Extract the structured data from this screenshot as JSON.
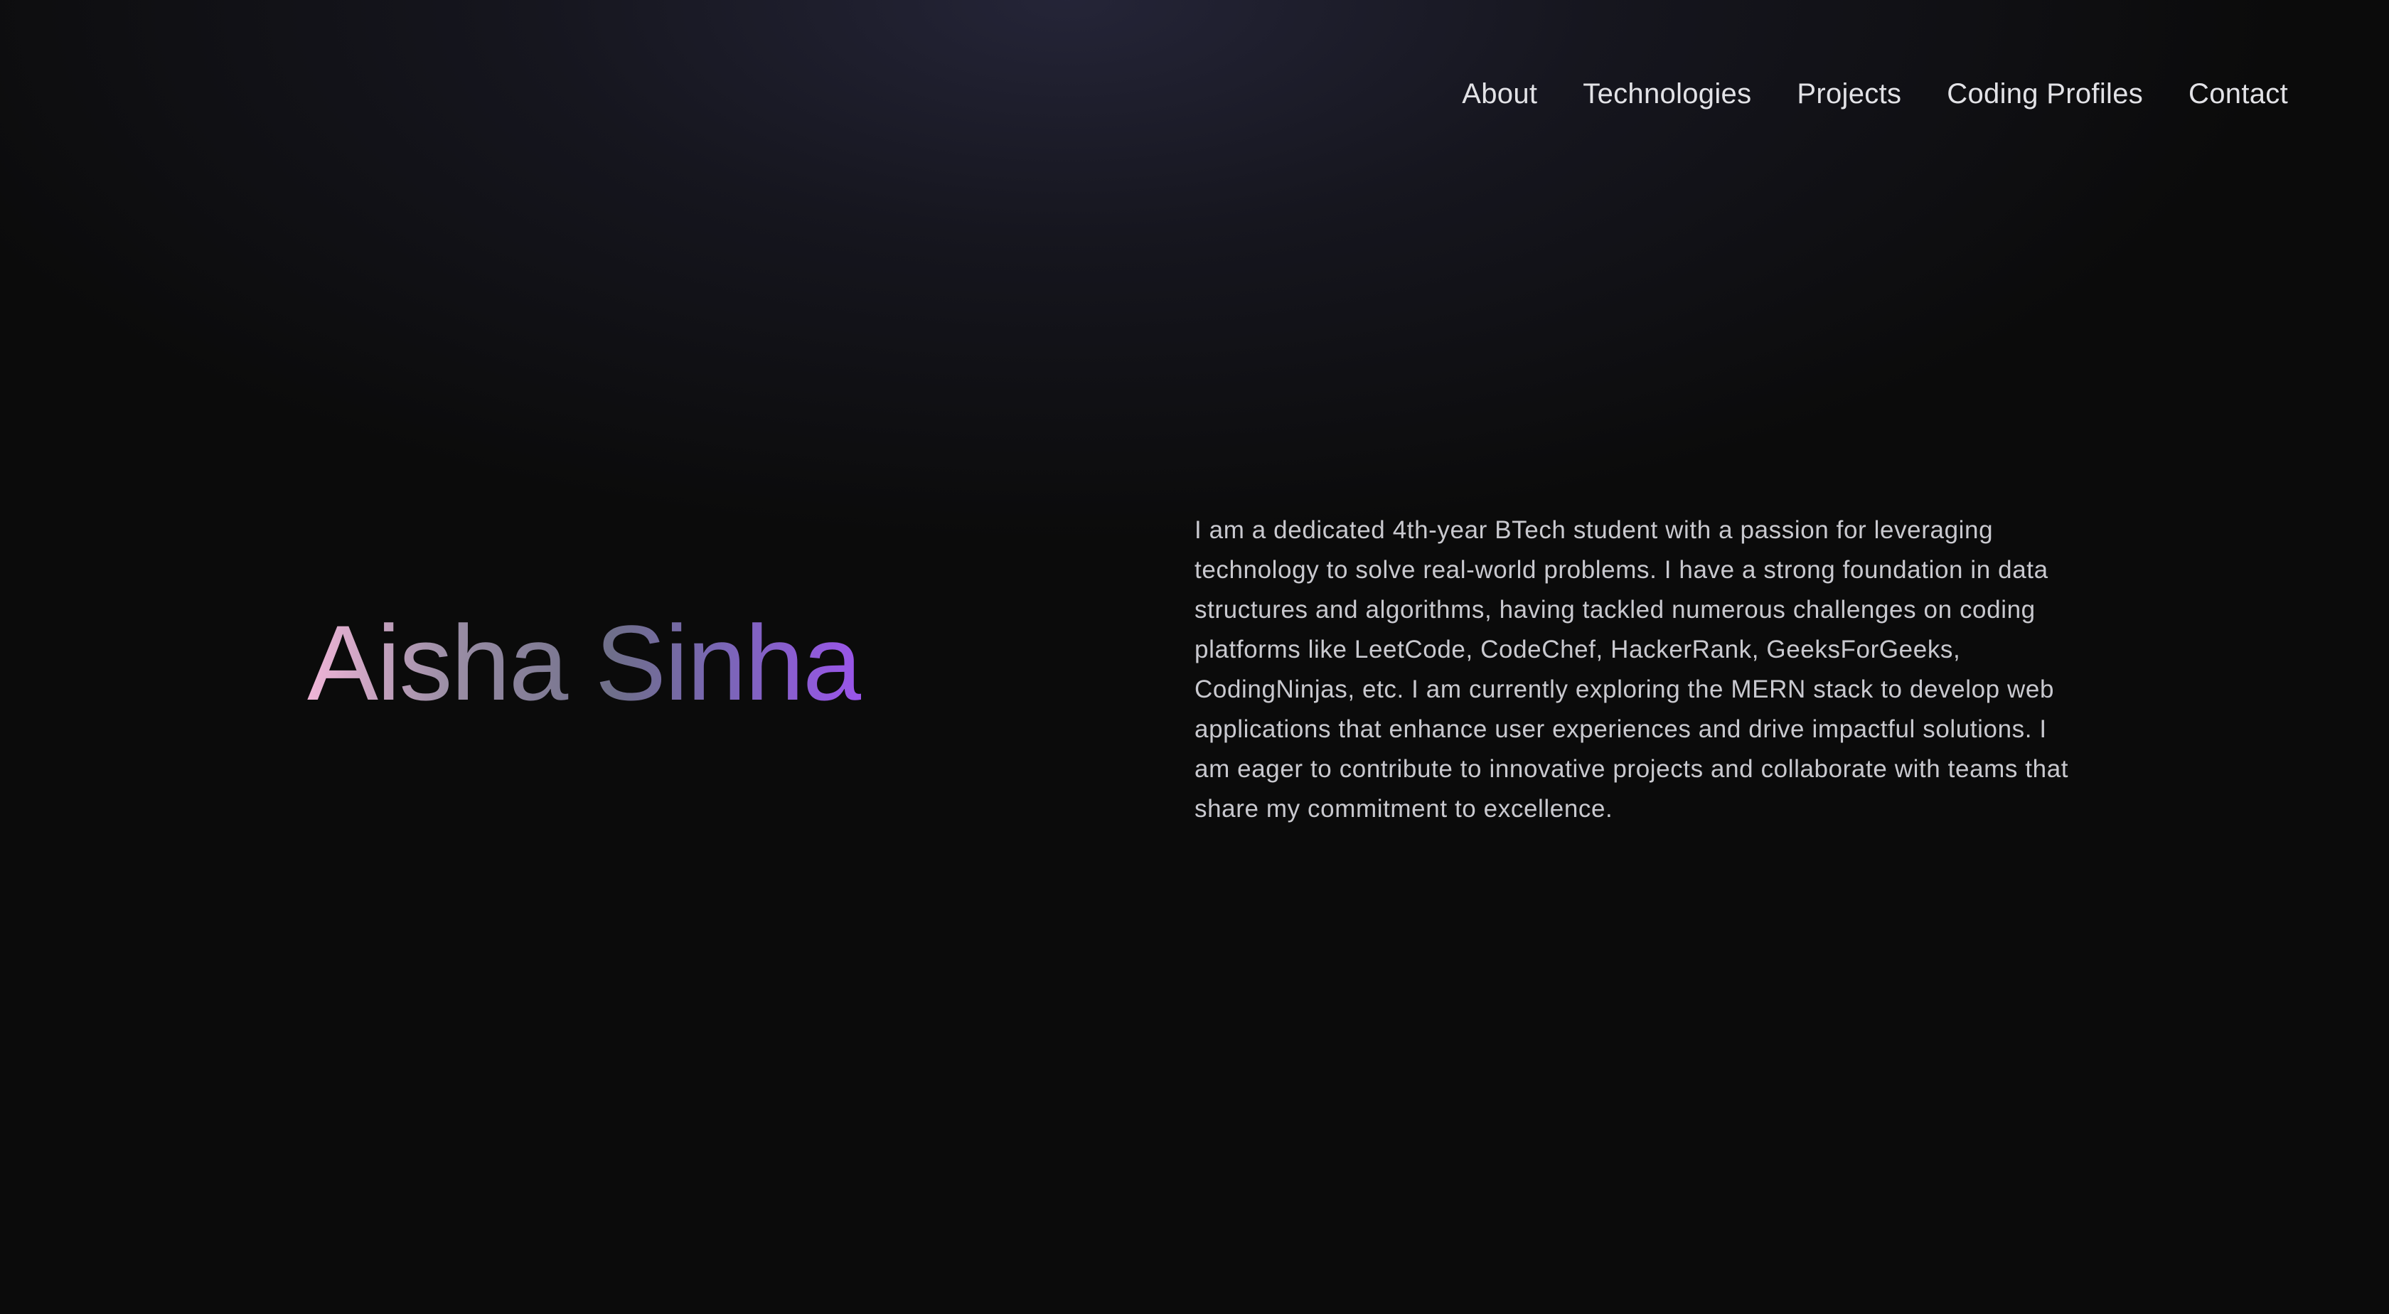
{
  "nav": {
    "items": [
      {
        "label": "About"
      },
      {
        "label": "Technologies"
      },
      {
        "label": "Projects"
      },
      {
        "label": "Coding Profiles"
      },
      {
        "label": "Contact"
      }
    ]
  },
  "hero": {
    "name": "Aisha Sinha",
    "bio": "I am a dedicated 4th-year BTech student with a passion for leveraging technology to solve real-world problems. I have a strong foundation in data structures and algorithms, having tackled numerous challenges on coding platforms like LeetCode, CodeChef, HackerRank, GeeksForGeeks, CodingNinjas, etc. I am currently exploring the MERN stack to develop web applications that enhance user experiences and drive impactful solutions. I am eager to contribute to innovative projects and collaborate with teams that share my commitment to excellence."
  },
  "colors": {
    "background": "#0b0b0b",
    "nav_text": "#e2e2e6",
    "bio_text": "#c9c9cf",
    "name_gradient_start": "#f0b5d8",
    "name_gradient_mid": "#6f6f8a",
    "name_gradient_end": "#9a55ea"
  }
}
